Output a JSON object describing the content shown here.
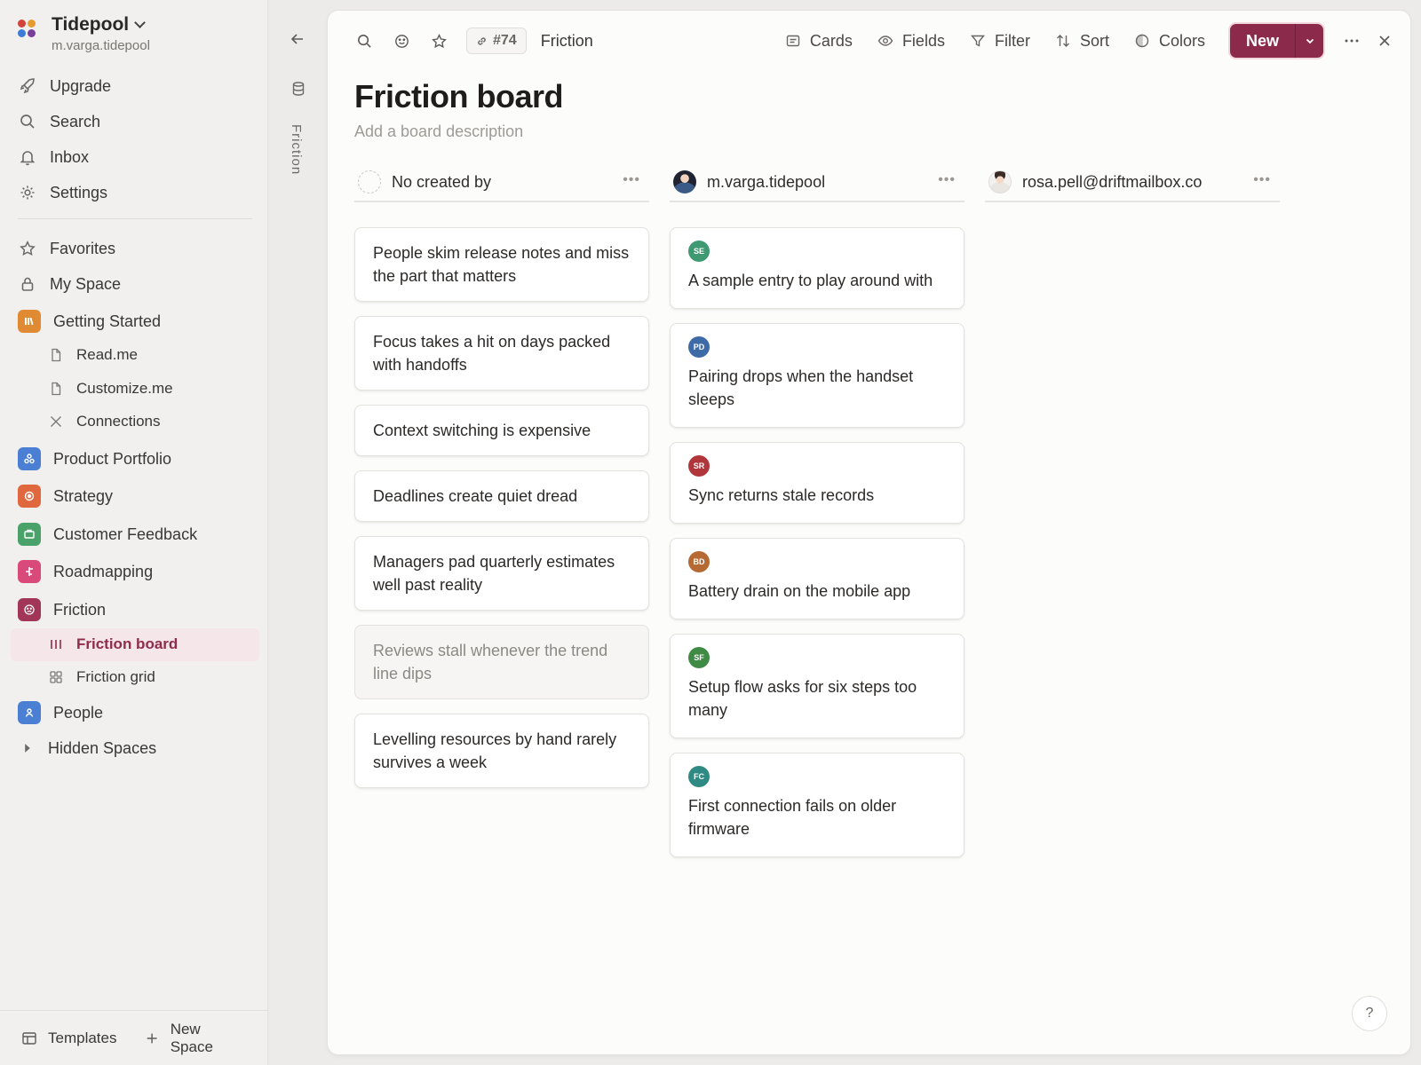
{
  "workspace": {
    "name": "Tidepool",
    "user": "m.varga.tidepool"
  },
  "nav": {
    "upgrade": "Upgrade",
    "search": "Search",
    "inbox": "Inbox",
    "settings": "Settings",
    "favorites": "Favorites",
    "my_space": "My Space"
  },
  "spaces": {
    "getting_started": "Getting Started",
    "readme": "Read.me",
    "customize": "Customize.me",
    "connections": "Connections",
    "product_portfolio": "Product Portfolio",
    "strategy": "Strategy",
    "customer_feedback": "Customer Feedback",
    "roadmapping": "Roadmapping",
    "friction": "Friction",
    "friction_board": "Friction board",
    "friction_grid": "Friction grid",
    "people": "People",
    "hidden_spaces": "Hidden Spaces"
  },
  "sidebar_bottom": {
    "templates": "Templates",
    "new_space": "New Space"
  },
  "strip": {
    "label": "Friction"
  },
  "toolbar": {
    "tag": "#74",
    "crumb": "Friction",
    "cards": "Cards",
    "fields": "Fields",
    "filter": "Filter",
    "sort": "Sort",
    "colors": "Colors",
    "new": "New"
  },
  "board": {
    "title": "Friction board",
    "description_placeholder": "Add a board description"
  },
  "columns": [
    {
      "title": "No created by",
      "cards": [
        {
          "text": "People skim release notes and miss the part that matters"
        },
        {
          "text": "Focus takes a hit on days packed with handoffs"
        },
        {
          "text": "Context switching is expensive"
        },
        {
          "text": "Deadlines create quiet dread"
        },
        {
          "text": "Managers pad quarterly estimates well past reality"
        },
        {
          "text": "Reviews stall whenever the trend line dips"
        },
        {
          "text": "Levelling resources by hand rarely survives a week"
        }
      ]
    },
    {
      "title": "m.varga.tidepool",
      "cards": [
        {
          "initials": "SE",
          "color": "#3f9a74",
          "text": "A sample entry to play around with"
        },
        {
          "initials": "PD",
          "color": "#3e6aa8",
          "text": "Pairing drops when the handset sleeps"
        },
        {
          "initials": "SR",
          "color": "#b0363c",
          "text": "Sync returns stale records"
        },
        {
          "initials": "BD",
          "color": "#b56a34",
          "text": "Battery drain on the mobile app"
        },
        {
          "initials": "SF",
          "color": "#3f8a44",
          "text": "Setup flow asks for six steps too many"
        },
        {
          "initials": "FC",
          "color": "#2e8a83",
          "text": "First connection fails on older firmware"
        }
      ]
    },
    {
      "title": "rosa.pell@driftmailbox.co",
      "cards": []
    }
  ],
  "help": "?"
}
